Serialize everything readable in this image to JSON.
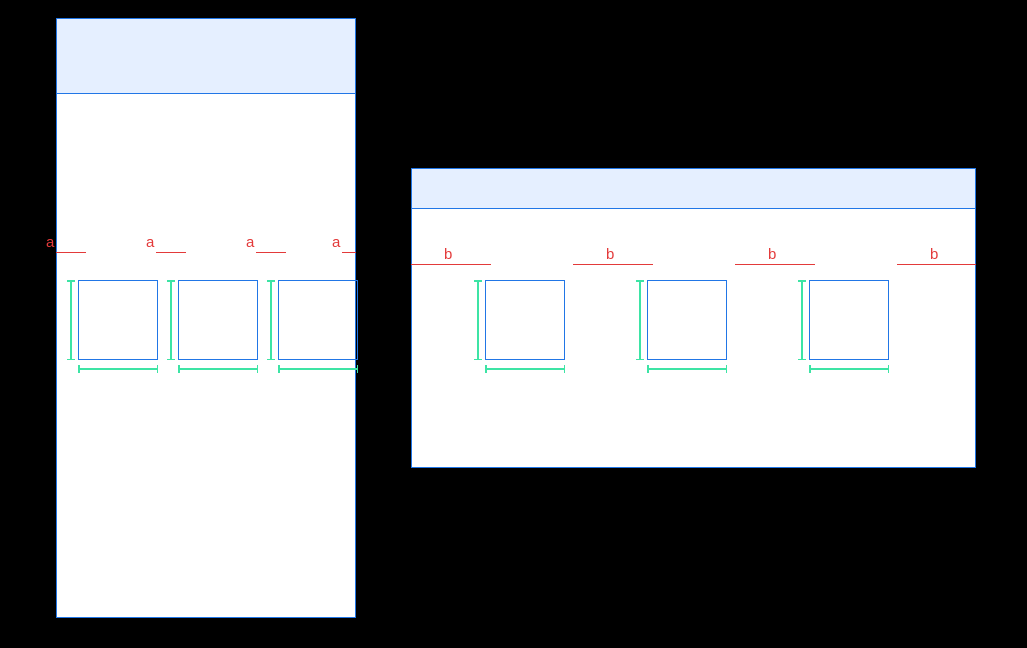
{
  "leftDiagram": {
    "labels": [
      "a",
      "a",
      "a",
      "a"
    ]
  },
  "rightDiagram": {
    "labels": [
      "b",
      "b",
      "b",
      "b"
    ]
  }
}
